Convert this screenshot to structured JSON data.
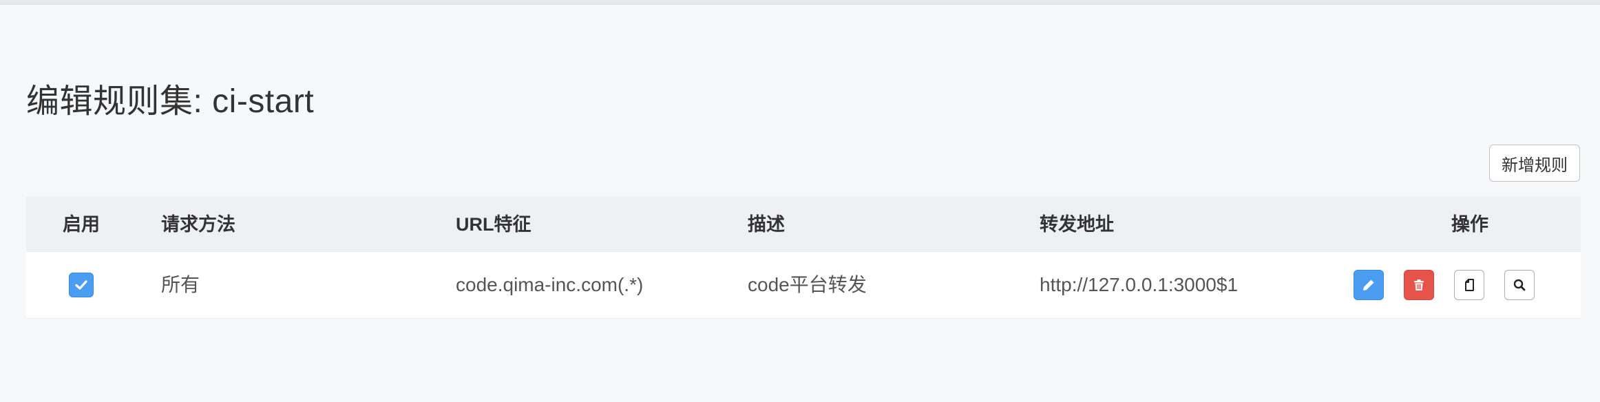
{
  "page": {
    "title": "编辑规则集: ci-start"
  },
  "toolbar": {
    "add_rule_label": "新增规则"
  },
  "table": {
    "headers": {
      "enable": "启用",
      "method": "请求方法",
      "url": "URL特征",
      "description": "描述",
      "forward": "转发地址",
      "actions": "操作"
    },
    "rows": [
      {
        "enabled": true,
        "method": "所有",
        "url": "code.qima-inc.com(.*)",
        "description": "code平台转发",
        "forward": "http://127.0.0.1:3000$1",
        "actions": [
          "edit-icon",
          "delete-icon",
          "copy-icon",
          "search-icon"
        ]
      }
    ]
  },
  "colors": {
    "primary": "#4a9df0",
    "danger": "#e5534b",
    "background": "#f7f8fa",
    "header_bg": "#eef0f4"
  }
}
